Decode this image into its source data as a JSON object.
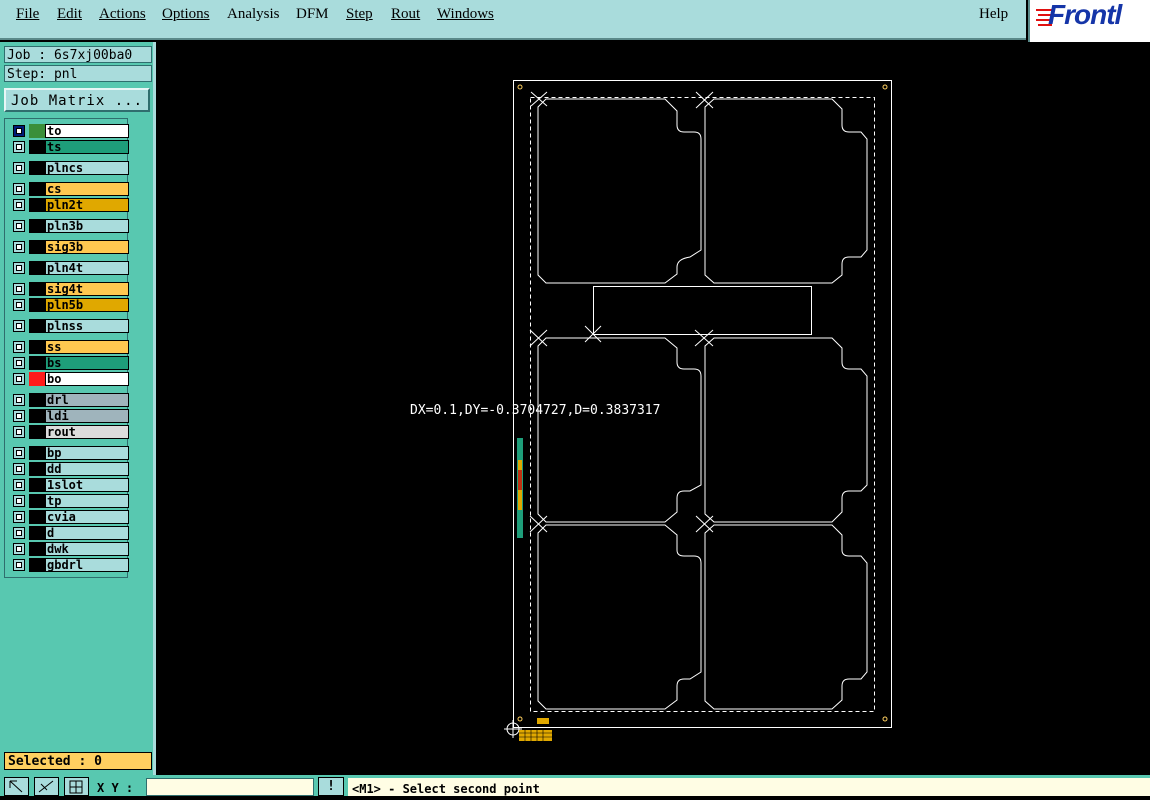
{
  "menubar": {
    "items": [
      "File",
      "Edit",
      "Actions",
      "Options",
      "Analysis",
      "DFM",
      "Step",
      "Rout",
      "Windows"
    ],
    "help": "Help"
  },
  "logo": {
    "text": "Frontl"
  },
  "job": {
    "job_label": "Job : 6s7xj00ba0",
    "step_label": "Step: pnl"
  },
  "job_matrix_button": "Job Matrix ...",
  "layers": [
    {
      "name": "to",
      "color": "#ffffff",
      "swatch": "#3a8f3a",
      "checked": true
    },
    {
      "name": "ts",
      "color": "#1e9e7a",
      "swatch": "#000000",
      "checked": false
    },
    {
      "name": "plncs",
      "color": "#a9dcdc",
      "swatch": "#000000",
      "checked": false
    },
    {
      "name": "cs",
      "color": "#ffc850",
      "swatch": "#000000",
      "checked": false
    },
    {
      "name": "pln2t",
      "color": "#e0a800",
      "swatch": "#000000",
      "checked": false
    },
    {
      "name": "pln3b",
      "color": "#a9dcdc",
      "swatch": "#000000",
      "checked": false
    },
    {
      "name": "sig3b",
      "color": "#ffc850",
      "swatch": "#000000",
      "checked": false
    },
    {
      "name": "pln4t",
      "color": "#a9dcdc",
      "swatch": "#000000",
      "checked": false
    },
    {
      "name": "sig4t",
      "color": "#ffc850",
      "swatch": "#000000",
      "checked": false
    },
    {
      "name": "pln5b",
      "color": "#e0a800",
      "swatch": "#000000",
      "checked": false
    },
    {
      "name": "plnss",
      "color": "#a9dcdc",
      "swatch": "#000000",
      "checked": false
    },
    {
      "name": "ss",
      "color": "#ffc850",
      "swatch": "#000000",
      "checked": false
    },
    {
      "name": "bs",
      "color": "#1e9e7a",
      "swatch": "#000000",
      "checked": false
    },
    {
      "name": "bo",
      "color": "#ffffff",
      "swatch": "#ff1a1a",
      "checked": false
    },
    {
      "name": "drl",
      "color": "#9fb4bc",
      "swatch": "#000000",
      "checked": false
    },
    {
      "name": "ldi",
      "color": "#9fb4bc",
      "swatch": "#000000",
      "checked": false
    },
    {
      "name": "rout",
      "color": "#dcdcdc",
      "swatch": "#000000",
      "checked": false
    },
    {
      "name": "bp",
      "color": "#a9dcdc",
      "swatch": "#000000",
      "checked": false
    },
    {
      "name": "dd",
      "color": "#a9dcdc",
      "swatch": "#000000",
      "checked": false
    },
    {
      "name": "1slot",
      "color": "#a9dcdc",
      "swatch": "#000000",
      "checked": false
    },
    {
      "name": "tp",
      "color": "#a9dcdc",
      "swatch": "#000000",
      "checked": false
    },
    {
      "name": "cvia",
      "color": "#a9dcdc",
      "swatch": "#000000",
      "checked": false
    },
    {
      "name": "d",
      "color": "#a9dcdc",
      "swatch": "#000000",
      "checked": false
    },
    {
      "name": "dwk",
      "color": "#a9dcdc",
      "swatch": "#000000",
      "checked": false
    },
    {
      "name": "gbdrl",
      "color": "#a9dcdc",
      "swatch": "#000000",
      "checked": false
    }
  ],
  "selected_label": "Selected : 0",
  "measurement": "DX=0.1,DY=-0.3704727,D=0.3837317",
  "bottombar": {
    "xy_label": "X Y :",
    "xy_value": "",
    "warn_label": "!",
    "status": "<M1> - Select second point"
  }
}
